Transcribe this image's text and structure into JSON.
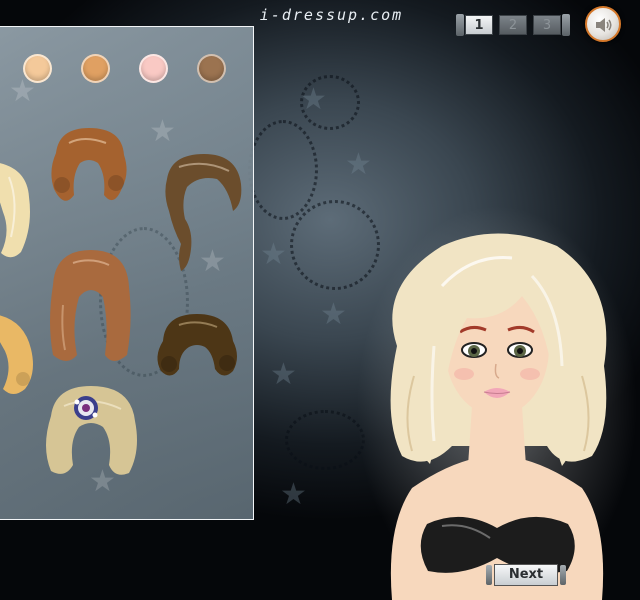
{
  "header": {
    "site_logo": "i-dressup.com"
  },
  "steps": [
    {
      "label": "1",
      "active": true
    },
    {
      "label": "2",
      "active": false
    },
    {
      "label": "3",
      "active": false
    }
  ],
  "sound_button": {
    "icon": "speaker-icon"
  },
  "skin_tones": [
    "#f4c99a",
    "#e0a062",
    "#f9c9c4",
    "#9b7350"
  ],
  "hair_options": [
    {
      "name": "blonde-wavy-partial",
      "color": "#f0dfae"
    },
    {
      "name": "auburn-curly-updo",
      "color": "#a5622f"
    },
    {
      "name": "brown-side-ponytail",
      "color": "#6b4d2c"
    },
    {
      "name": "auburn-long-straight",
      "color": "#a96a3e"
    },
    {
      "name": "golden-curly-partial",
      "color": "#e9b865"
    },
    {
      "name": "dark-brown-curly-bob",
      "color": "#4d3616"
    },
    {
      "name": "blonde-with-flower-clip",
      "color": "#d6c595"
    }
  ],
  "model": {
    "hair_color": "#f1e4c4",
    "skin_color": "#f7d8bd",
    "top_color": "#1c1c1c"
  },
  "next_button": {
    "label": "Next"
  }
}
